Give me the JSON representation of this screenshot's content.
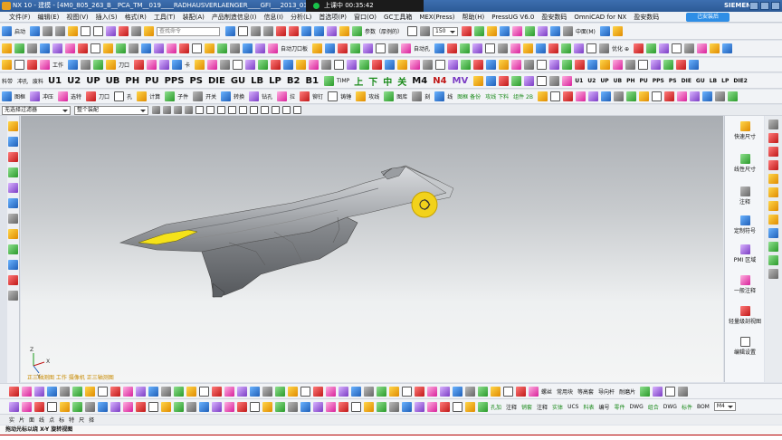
{
  "titlebar": {
    "title": "NX 10 - 建模 - [4M0_805_263_B__PCA_TM__019____RADHAUSVERLAENGER____GFI___2013_03_22_catpart",
    "recording": "上课中 00:35:42",
    "brand": "SIEMENS"
  },
  "menu": {
    "items": [
      "文件(F)",
      "编辑(E)",
      "视图(V)",
      "插入(S)",
      "格式(R)",
      "工具(T)",
      "装配(A)",
      "产品制造信息(I)",
      "信息(I)",
      "分析(L)",
      "首选项(P)",
      "窗口(O)",
      "GC工具箱",
      "MEX(Press)",
      "帮助(H)",
      "PressUG V6.0",
      "盈安数码",
      "OmniCAD for NX",
      "盈安数码"
    ],
    "cloud_label": "己安装后"
  },
  "toolbar1": {
    "start_label": "启动",
    "search_placeholder": "查找命令",
    "param_label": "参数（厚例的）",
    "num_field": "150",
    "center_label": "中面(M)"
  },
  "toolbar2": {
    "labels": [
      "自动刀口板",
      "自动孔",
      "优化 ⊕"
    ],
    "side_labels": [
      "工作",
      "刀口",
      "卡"
    ]
  },
  "toolbar3": {
    "big": [
      "U1",
      "U2",
      "UP",
      "UB",
      "PH",
      "PU",
      "PPS",
      "PS",
      "DIE",
      "GU",
      "LB",
      "LP",
      "B2",
      "B1"
    ],
    "right_big": [
      "U1",
      "U2",
      "UP",
      "UB",
      "PH",
      "PU",
      "PPS",
      "PS",
      "DIE",
      "GU",
      "LB",
      "LP",
      "DIE2"
    ],
    "chinese": [
      "上",
      "下",
      "中",
      "关"
    ],
    "labels": [
      "料带",
      "冲孔",
      "废料",
      "TIMP",
      "M4",
      "N4",
      "MV"
    ]
  },
  "toolbar4": {
    "labels": [
      "图框",
      "冲压",
      "选特",
      "刀口",
      "孔",
      "计算",
      "子件",
      "开关",
      "转换",
      "钻孔",
      "拉",
      "铆钉",
      "铸锤",
      "攻线",
      "图库",
      "刻",
      "线"
    ],
    "buttons": [
      "图框 备份",
      "攻线 下料",
      "组件 2B"
    ]
  },
  "filter_bar": {
    "filter": "无选择过滤器",
    "assembly": "整个装配"
  },
  "right_panel": {
    "items": [
      "快速尺寸",
      "线性尺寸",
      "注释",
      "定制符号",
      "PMI 区域",
      "一般注释",
      "轻量级剖视图",
      "编辑设置"
    ]
  },
  "viewport": {
    "status_text": "正三轴测图  工作 摄像机 正三轴测图",
    "axis_labels": [
      "Y",
      "Z",
      "X"
    ]
  },
  "bottom_toolbar": {
    "labels": [
      "螺丝",
      "常用块",
      "等高套",
      "导向杆",
      "耐磨片"
    ],
    "label2": [
      "孔加",
      "注释",
      "销套",
      "注释",
      "实体",
      "UCS",
      "料表",
      "编号",
      "零件",
      "DWG",
      "组合",
      "DWG",
      "标件",
      "BOM"
    ],
    "m_field": "M4"
  },
  "cue_line": "拖动光标以绕 X-Y 旋转视图",
  "bottom_row2": {
    "labels": [
      "实",
      "片",
      "面",
      "线",
      "点",
      "标",
      "特",
      "尺",
      "择"
    ]
  }
}
